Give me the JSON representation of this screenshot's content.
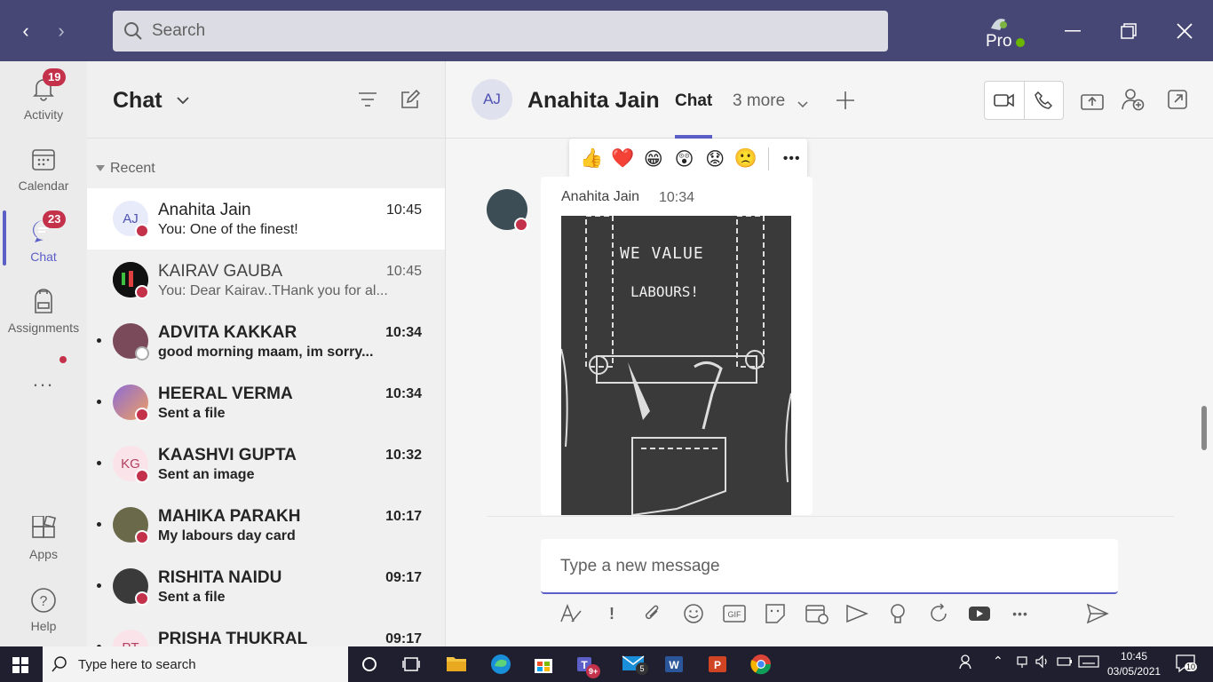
{
  "search": {
    "placeholder": "Search"
  },
  "rail": {
    "activity": {
      "label": "Activity",
      "badge": "19"
    },
    "calendar": {
      "label": "Calendar"
    },
    "chat": {
      "label": "Chat",
      "badge": "23"
    },
    "assignments": {
      "label": "Assignments"
    },
    "more": {
      "label": "..."
    },
    "apps": {
      "label": "Apps"
    },
    "help": {
      "label": "Help"
    }
  },
  "chatlist": {
    "title": "Chat",
    "section": "Recent",
    "items": [
      {
        "initials": "AJ",
        "name": "Anahita Jain",
        "time": "10:45",
        "preview": "You: One of the finest!"
      },
      {
        "initials": "",
        "name": "KAIRAV GAUBA",
        "time": "10:45",
        "preview": "You: Dear Kairav..THank you for al..."
      },
      {
        "initials": "",
        "name": "ADVITA KAKKAR",
        "time": "10:34",
        "preview": "good morning maam, im sorry..."
      },
      {
        "initials": "",
        "name": "HEERAL VERMA",
        "time": "10:34",
        "preview": "Sent a file"
      },
      {
        "initials": "KG",
        "name": "KAASHVI GUPTA",
        "time": "10:32",
        "preview": "Sent an image"
      },
      {
        "initials": "",
        "name": "MAHIKA PARAKH",
        "time": "10:17",
        "preview": "My labours day card"
      },
      {
        "initials": "",
        "name": "RISHITA NAIDU",
        "time": "09:17",
        "preview": "Sent a file"
      },
      {
        "initials": "PT",
        "name": "PRISHA THUKRAL",
        "time": "09:17",
        "preview": ""
      }
    ]
  },
  "header": {
    "initials": "AJ",
    "name": "Anahita Jain",
    "tab_chat": "Chat",
    "tab_more": "3 more"
  },
  "reactions": [
    "👍",
    "❤️",
    "😁",
    "😲",
    "😟",
    "🙁"
  ],
  "message": {
    "sender": "Anahita Jain",
    "time": "10:34",
    "card_line1": "WE VALUE",
    "card_line2": "LABOURS!"
  },
  "compose": {
    "placeholder": "Type a new message"
  },
  "taskbar": {
    "search_placeholder": "Type here to search",
    "time": "10:45",
    "date": "03/05/2021",
    "notif": "10",
    "teams_badge": "9+",
    "mail_badge": "5"
  },
  "pro_label": "Pro"
}
